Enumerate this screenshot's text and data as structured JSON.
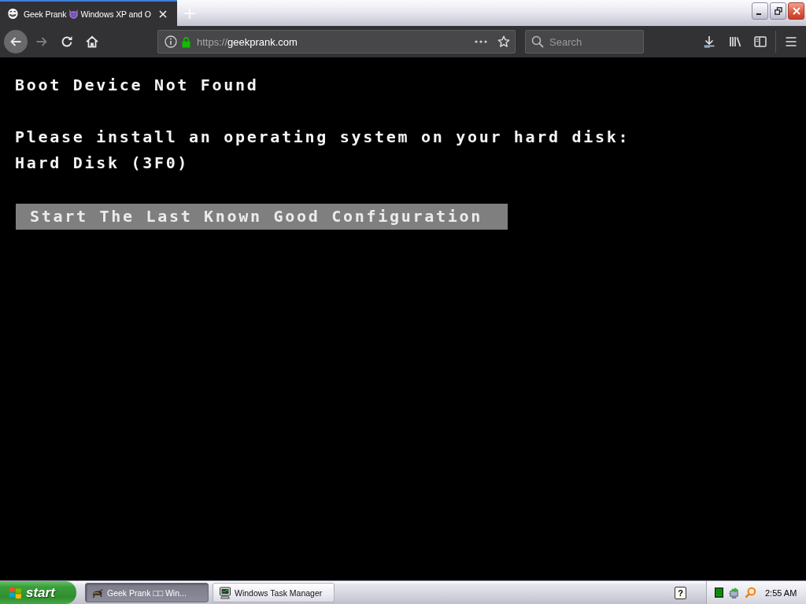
{
  "browser": {
    "tabs": [
      {
        "title_start": "Geek Prank",
        "title_end": "Windows XP and O",
        "selected": true
      }
    ],
    "nav_buttons": [
      {
        "kind": "back",
        "disabled": false
      },
      {
        "kind": "forward",
        "disabled": true
      },
      {
        "kind": "reload",
        "disabled": false
      },
      {
        "kind": "home",
        "disabled": false
      }
    ],
    "address_bar": {
      "scheme": "https://",
      "host": "geekprank.com"
    },
    "search": {
      "placeholder": "Search"
    }
  },
  "screen": {
    "title": "Boot Device Not Found",
    "message": [
      "Please install an operating system on your hard disk:",
      "Hard Disk (3F0)"
    ],
    "options": [
      {
        "label": "Start The Last Known Good Configuration",
        "selected": true
      }
    ]
  },
  "taskbar": {
    "start_label": "start",
    "tasks": [
      {
        "kind": "browser",
        "label": "Geek Prank □□ Win...",
        "selected": true
      },
      {
        "kind": "app",
        "label": "Windows Task Manager",
        "selected": false
      }
    ],
    "help_label": "?",
    "clock": "2:55 AM"
  }
}
